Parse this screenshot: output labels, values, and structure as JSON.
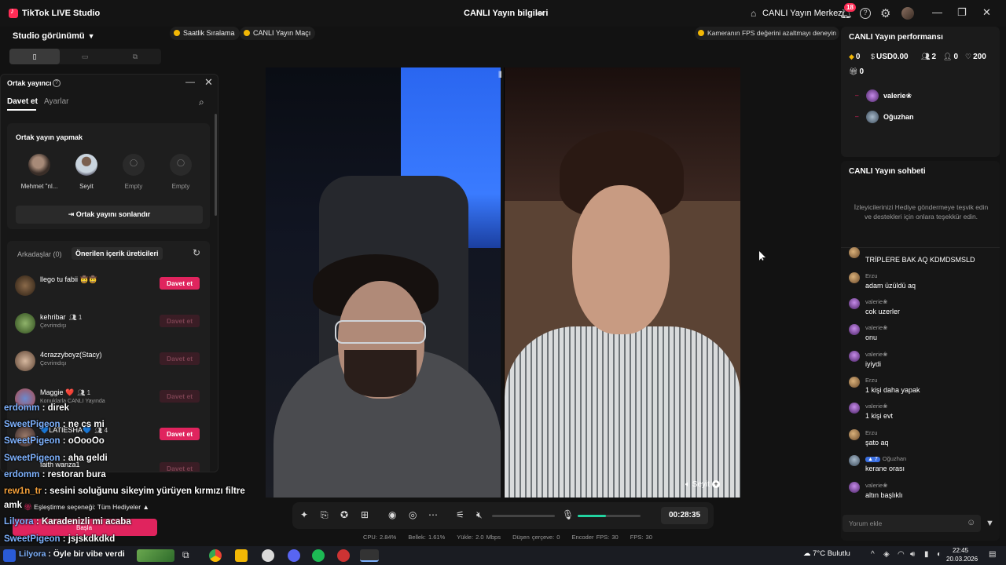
{
  "titlebar": {
    "app_title": "TikTok LIVE Studio",
    "center_title": "CANLI Yayın bilgileri",
    "live_center": "CANLI Yayın Merkezi",
    "notif_count": "18"
  },
  "studio": {
    "view_label": "Studio görünümü",
    "orientations": [
      "portrait-icon",
      "landscape-icon",
      "dual-icon"
    ]
  },
  "top_pills": {
    "hourly_ranking": "Saatlik Sıralama",
    "live_match": "CANLI Yayın Maçı",
    "fps_tip": "Kameranın FPS değerini azaltmayı deneyin"
  },
  "cohost": {
    "title": "Ortak yayıncı",
    "tab_invite": "Davet et",
    "tab_settings": "Ayarlar",
    "make_title": "Ortak yayın yapmak",
    "guests": [
      {
        "name": "Mehmet \"nl...",
        "empty": false
      },
      {
        "name": "Seyit",
        "empty": false
      },
      {
        "name": "Empty",
        "empty": true
      },
      {
        "name": "Empty",
        "empty": true
      }
    ],
    "end_button": "Ortak yayını sonlandır",
    "friends_tab": "Arkadaşlar (0)",
    "suggested_tab": "Önerilen içerik üreticileri",
    "invite_label": "Davet et",
    "creators": [
      {
        "name": "llego tu fabii 🤠🤠",
        "count": "",
        "status": "",
        "invite_enabled": true
      },
      {
        "name": "kehribar",
        "count": "1",
        "status": "Çevrimdışı",
        "invite_enabled": false
      },
      {
        "name": "4crazzyboyz(Stacy)",
        "count": "",
        "status": "Çevrimdışı",
        "invite_enabled": false
      },
      {
        "name": "Maggie ❤️",
        "count": "1",
        "status": "Konuklarla CANLI Yayında",
        "invite_enabled": false
      },
      {
        "name": "💙LATIESHA💙",
        "count": "4",
        "status": "",
        "invite_enabled": true
      },
      {
        "name": "faith wanza1",
        "count": "",
        "status": "",
        "invite_enabled": false
      }
    ]
  },
  "overlay_chat": [
    {
      "user": "erdomm",
      "text": " : direk",
      "color": "u1"
    },
    {
      "user": "SweetPigeon",
      "text": " : ne cs mi",
      "color": "u1"
    },
    {
      "user": "SweetPigeon",
      "text": " : oOooOo",
      "color": "u1"
    },
    {
      "user": "SweetPigeon",
      "text": " : aha geldi",
      "color": "u1"
    },
    {
      "user": "erdomm",
      "text": " : restoran bura",
      "color": "u1"
    },
    {
      "user": "rew1n_tr",
      "text": " : sesini soluğunu sikeyim yürüyen kırmızı filtre",
      "color": "u2"
    },
    {
      "user": "",
      "text": "amk",
      "color": ""
    },
    {
      "user": "Lilyora",
      "text": " : Karadenizli mi acaba",
      "color": "u1"
    },
    {
      "user": "SweetPigeon",
      "text": " : jsjskdkdkd",
      "color": "u1"
    },
    {
      "user": "Lilyora",
      "text": " : Öyle bir vibe verdi",
      "color": "u1"
    }
  ],
  "gift_filter": "Eşleştirme seçeneği: Tüm Hediyeler",
  "start_button": "Başla",
  "stage": {
    "speaker_name": "Seyit",
    "timer": "00:28:35",
    "mic_level": 0.45
  },
  "stats": {
    "cpu": "CPU: 2.84%",
    "memory": "Bellek: 1.61%",
    "upload": "Yükle: 2.0 Mbps",
    "dropped": "Düşen çerçeve: 0",
    "encoder_fps": "Encoder FPS: 30",
    "fps": "FPS: 30"
  },
  "performance": {
    "title": "CANLI Yayın performansı",
    "diamonds": "0",
    "usd": "USD0.00",
    "viewers": "2",
    "new_followers": "0",
    "likes": "200",
    "gifts": "0",
    "viewer_list": [
      "valerie❀",
      "Oğuzhan"
    ]
  },
  "chat": {
    "title": "CANLI Yayın sohbeti",
    "hint": "İzleyicilerinizi Hediye göndermeye teşvik edin ve destekleri için onlara teşekkür edin.",
    "messages": [
      {
        "name": "Erzu",
        "text": "TRİPLERE BAK AQ KDMDSMSLD",
        "av": "erzu",
        "level": ""
      },
      {
        "name": "Erzu",
        "text": "adam üzüldü aq",
        "av": "erzu",
        "level": ""
      },
      {
        "name": "valerie❀",
        "text": "cok uzerler",
        "av": "val",
        "level": ""
      },
      {
        "name": "valerie❀",
        "text": "onu",
        "av": "val",
        "level": ""
      },
      {
        "name": "valerie❀",
        "text": "iyiydi",
        "av": "val",
        "level": ""
      },
      {
        "name": "Erzu",
        "text": "1 kişi daha yapak",
        "av": "erzu",
        "level": ""
      },
      {
        "name": "valerie❀",
        "text": "1 kişi evt",
        "av": "val",
        "level": ""
      },
      {
        "name": "Erzu",
        "text": "şato aq",
        "av": "erzu",
        "level": ""
      },
      {
        "name": "Oğuzhan",
        "text": "kerane orası",
        "av": "ogz",
        "level": "7"
      },
      {
        "name": "valerie❀",
        "text": "altın başlıklı",
        "av": "val",
        "level": ""
      }
    ],
    "comment_placeholder": "Yorum ekle"
  },
  "taskbar": {
    "weather": "7°C  Bulutlu",
    "time": "22:45",
    "date": "20.03.2026"
  }
}
